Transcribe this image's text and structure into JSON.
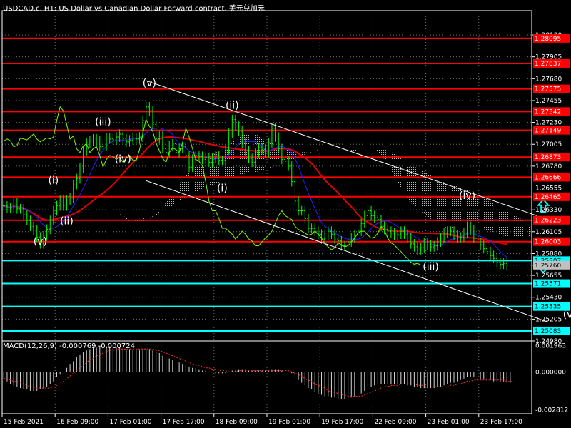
{
  "header": {
    "title": "USDCAD.c, H1:  US Dollar vs Canadian Dollar Forward contract, 美元兑加元"
  },
  "macd_label": "MACD(12,26,9) -0.000769 -0.000724",
  "colors": {
    "background": "#000000",
    "grid": "#6e6e6e",
    "candle": "#00ff00",
    "level_line": "#ff0000",
    "support_line": "#00ffff",
    "channel": "#ffffff",
    "kijun": "#e00000",
    "tenkan": "#2020ff",
    "chikou": "#7cfc00",
    "cloud_dots": "#d9d9d9",
    "macd_hist": "#d9d9d9",
    "macd_signal": "#ff3333",
    "label_text": "#ffffff"
  },
  "chart_data": [
    {
      "type": "line",
      "symbol": "USDCAD.c",
      "timeframe": "H1",
      "ylim": [
        1.2498,
        1.2838
      ],
      "y_ticks": [
        "1.28130",
        "1.27905",
        "1.27680",
        "1.27455",
        "1.27230",
        "1.27005",
        "1.26780",
        "1.26555",
        "1.26330",
        "1.26105",
        "1.25880",
        "1.25760",
        "1.25655",
        "1.25430",
        "1.25205",
        "1.24980"
      ],
      "x_ticks": [
        "15 Feb 2021",
        "16 Feb 09:00",
        "17 Feb 01:00",
        "17 Feb 17:00",
        "18 Feb 09:00",
        "19 Feb 01:00",
        "19 Feb 17:00",
        "22 Feb 09:00",
        "23 Feb 01:00",
        "23 Feb 17:00"
      ],
      "red_levels": [
        {
          "label": "1.28095",
          "value": 1.28095
        },
        {
          "label": "1.27837",
          "value": 1.27837
        },
        {
          "label": "1.27575",
          "value": 1.27575
        },
        {
          "label": "1.27342",
          "value": 1.27342
        },
        {
          "label": "1.27149",
          "value": 1.27149
        },
        {
          "label": "1.26873",
          "value": 1.26873
        },
        {
          "label": "1.26666",
          "value": 1.26666
        },
        {
          "label": "1.26465",
          "value": 1.26465
        },
        {
          "label": "1.26223",
          "value": 1.26223
        },
        {
          "label": "1.26003",
          "value": 1.26003
        }
      ],
      "cyan_levels": [
        {
          "label": "1.25807",
          "value": 1.25807
        },
        {
          "label": "1.25571",
          "value": 1.25571
        },
        {
          "label": "1.25335",
          "value": 1.25335
        },
        {
          "label": "1.25083",
          "value": 1.25083
        }
      ],
      "current_price": {
        "label": "1.25760",
        "value": 1.2576
      },
      "wave_labels": [
        {
          "text": "(v)",
          "bar": 44,
          "price": 1.276
        },
        {
          "text": "(iii)",
          "bar": 30,
          "price": 1.272
        },
        {
          "text": "(iv)",
          "bar": 36,
          "price": 1.2682
        },
        {
          "text": "(ii)",
          "bar": 69,
          "price": 1.2737
        },
        {
          "text": "(i)",
          "bar": 66,
          "price": 1.2652
        },
        {
          "text": "(i)",
          "bar": 15,
          "price": 1.266
        },
        {
          "text": "(ii)",
          "bar": 19,
          "price": 1.2618
        },
        {
          "text": "(v)",
          "bar": 11,
          "price": 1.2597
        },
        {
          "text": "(iii)",
          "bar": 129,
          "price": 1.2571
        },
        {
          "text": "(iv)",
          "bar": 140,
          "price": 1.2644
        },
        {
          "text": "(v)",
          "bar": 171,
          "price": 1.2522
        }
      ],
      "channel_lines": [
        {
          "bar1": 43,
          "price1": 1.2766,
          "bar2": 161,
          "price2": 1.2627
        },
        {
          "bar1": 43,
          "price1": 1.2663,
          "bar2": 164,
          "price2": 1.2518
        }
      ],
      "arrows": [
        {
          "direction": "up",
          "bar": 163,
          "price": 1.2637
        },
        {
          "direction": "down",
          "bar": 163,
          "price": 1.2575
        }
      ],
      "series": [
        {
          "kind": "close",
          "values": [
            1.2637,
            1.2635,
            1.2635,
            1.264,
            1.2634,
            1.2634,
            1.2628,
            1.2622,
            1.2616,
            1.2612,
            1.2605,
            1.2598,
            1.2606,
            1.2613,
            1.2622,
            1.2632,
            1.2637,
            1.2643,
            1.2637,
            1.2643,
            1.2645,
            1.2659,
            1.2665,
            1.2676,
            1.2694,
            1.2702,
            1.2704,
            1.2706,
            1.2704,
            1.2698,
            1.2699,
            1.2707,
            1.2706,
            1.2705,
            1.2708,
            1.2711,
            1.2706,
            1.2703,
            1.2705,
            1.2707,
            1.2706,
            1.2708,
            1.2725,
            1.2739,
            1.2735,
            1.2721,
            1.2706,
            1.2709,
            1.2696,
            1.2692,
            1.2699,
            1.2701,
            1.2692,
            1.2696,
            1.2698,
            1.2689,
            1.2677,
            1.2685,
            1.2689,
            1.2688,
            1.2685,
            1.2687,
            1.2682,
            1.2686,
            1.2689,
            1.2684,
            1.2684,
            1.2695,
            1.2712,
            1.2726,
            1.2719,
            1.2714,
            1.2702,
            1.2694,
            1.2686,
            1.2682,
            1.2692,
            1.2697,
            1.2695,
            1.2692,
            1.2702,
            1.2717,
            1.2708,
            1.2696,
            1.2685,
            1.2683,
            1.2678,
            1.2662,
            1.2642,
            1.2632,
            1.2632,
            1.2624,
            1.2614,
            1.2614,
            1.2611,
            1.2608,
            1.2603,
            1.2607,
            1.2611,
            1.2608,
            1.2603,
            1.2601,
            1.2596,
            1.2596,
            1.26,
            1.2604,
            1.2607,
            1.2611,
            1.2619,
            1.2627,
            1.2632,
            1.2627,
            1.2625,
            1.2623,
            1.2616,
            1.2613,
            1.2611,
            1.2609,
            1.2607,
            1.2608,
            1.2611,
            1.2608,
            1.2604,
            1.2598,
            1.2595,
            1.2592,
            1.2594,
            1.2599,
            1.2597,
            1.2595,
            1.2596,
            1.26,
            1.2604,
            1.2609,
            1.2611,
            1.2611,
            1.2607,
            1.2604,
            1.2605,
            1.2609,
            1.2616,
            1.2612,
            1.2604,
            1.2599,
            1.2597,
            1.2593,
            1.259,
            1.2586,
            1.2583,
            1.2579,
            1.2577,
            1.2578,
            1.2576
          ]
        }
      ]
    },
    {
      "type": "bar",
      "name": "MACD(12,26,9)",
      "ylim": [
        -0.0031,
        0.0023
      ],
      "y_ticks": [
        "0.001963",
        "0.000000",
        "-0.002812"
      ],
      "series": [
        {
          "kind": "main",
          "values": [
            -0.0005,
            -0.0007,
            -0.0009,
            -0.001,
            -0.0011,
            -0.0012,
            -0.0013,
            -0.0013,
            -0.0014,
            -0.0014,
            -0.0014,
            -0.0013,
            -0.0012,
            -0.0011,
            -0.0009,
            -0.0007,
            -0.0004,
            -0.0002,
            0.0,
            0.0003,
            0.0006,
            0.0008,
            0.0011,
            0.0013,
            0.0015,
            0.0016,
            0.0017,
            0.0018,
            0.0018,
            0.0019,
            0.0019,
            0.0019,
            0.0019,
            0.0018,
            0.0018,
            0.0018,
            0.0017,
            0.0017,
            0.0017,
            0.0016,
            0.0016,
            0.0016,
            0.0016,
            0.0017,
            0.0017,
            0.0016,
            0.0015,
            0.0014,
            0.0012,
            0.0011,
            0.001,
            0.0009,
            0.0008,
            0.0007,
            0.0006,
            0.0005,
            0.0004,
            0.0003,
            0.0003,
            0.0002,
            0.0001,
            0.0001,
            0.0,
            -0.0,
            -0.0001,
            -0.0001,
            -0.0001,
            -0.0001,
            -0.0,
            0.0001,
            0.0001,
            0.0002,
            0.0002,
            0.0002,
            0.0001,
            0.0001,
            0.0001,
            0.0001,
            0.0001,
            0.0001,
            0.0001,
            0.0002,
            0.0002,
            0.0002,
            0.0001,
            0.0001,
            0.0,
            -0.0001,
            -0.0004,
            -0.0006,
            -0.0008,
            -0.001,
            -0.0012,
            -0.0013,
            -0.0015,
            -0.0016,
            -0.0017,
            -0.0018,
            -0.0018,
            -0.0019,
            -0.0019,
            -0.002,
            -0.002,
            -0.002,
            -0.002,
            -0.0019,
            -0.0018,
            -0.0017,
            -0.0016,
            -0.0014,
            -0.0012,
            -0.0011,
            -0.001,
            -0.0009,
            -0.0009,
            -0.0009,
            -0.0009,
            -0.0009,
            -0.0009,
            -0.0009,
            -0.0009,
            -0.0009,
            -0.001,
            -0.001,
            -0.0011,
            -0.0011,
            -0.0012,
            -0.0012,
            -0.0012,
            -0.0012,
            -0.0012,
            -0.0011,
            -0.0011,
            -0.001,
            -0.0009,
            -0.0008,
            -0.0008,
            -0.0007,
            -0.0006,
            -0.0005,
            -0.0004,
            -0.0004,
            -0.0004,
            -0.0005,
            -0.0005,
            -0.0005,
            -0.0006,
            -0.0006,
            -0.0007,
            -0.0007,
            -0.0007,
            -0.0007,
            -0.0007,
            -0.0008
          ]
        },
        {
          "kind": "signal",
          "values": [
            -0.0005,
            -0.0005,
            -0.0006,
            -0.0007,
            -0.0007,
            -0.0008,
            -0.0009,
            -0.001,
            -0.0011,
            -0.0011,
            -0.0012,
            -0.0012,
            -0.0012,
            -0.0012,
            -0.0012,
            -0.0011,
            -0.001,
            -0.0008,
            -0.0007,
            -0.0005,
            -0.0003,
            -0.0001,
            0.0001,
            0.0003,
            0.0005,
            0.0007,
            0.0009,
            0.001,
            0.0012,
            0.0013,
            0.0014,
            0.0015,
            0.0016,
            0.0016,
            0.0017,
            0.0017,
            0.0017,
            0.0017,
            0.0017,
            0.0017,
            0.0017,
            0.0017,
            0.0017,
            0.0017,
            0.0017,
            0.0017,
            0.0016,
            0.0016,
            0.0015,
            0.0014,
            0.0013,
            0.0012,
            0.0011,
            0.001,
            0.0009,
            0.0008,
            0.0007,
            0.0006,
            0.0005,
            0.0005,
            0.0004,
            0.0003,
            0.0003,
            0.0002,
            0.0002,
            0.0001,
            0.0001,
            0.0001,
            0.0,
            0.0,
            0.0,
            0.0001,
            0.0001,
            0.0001,
            0.0001,
            0.0001,
            0.0001,
            0.0001,
            0.0001,
            0.0001,
            0.0001,
            0.0001,
            0.0001,
            0.0001,
            0.0001,
            0.0001,
            0.0001,
            0.0,
            -0.0001,
            -0.0002,
            -0.0003,
            -0.0005,
            -0.0006,
            -0.0007,
            -0.0009,
            -0.001,
            -0.0011,
            -0.0012,
            -0.0014,
            -0.0015,
            -0.0015,
            -0.0016,
            -0.0017,
            -0.0017,
            -0.0018,
            -0.0018,
            -0.0018,
            -0.0018,
            -0.0018,
            -0.0017,
            -0.0016,
            -0.0015,
            -0.0014,
            -0.0013,
            -0.0012,
            -0.0011,
            -0.0011,
            -0.001,
            -0.001,
            -0.001,
            -0.0009,
            -0.0009,
            -0.0009,
            -0.0009,
            -0.0009,
            -0.001,
            -0.001,
            -0.001,
            -0.0011,
            -0.0011,
            -0.0011,
            -0.0011,
            -0.0011,
            -0.0011,
            -0.0011,
            -0.001,
            -0.001,
            -0.0009,
            -0.0009,
            -0.0008,
            -0.0007,
            -0.0007,
            -0.0006,
            -0.0006,
            -0.0006,
            -0.0006,
            -0.0006,
            -0.0006,
            -0.0006,
            -0.0006,
            -0.0006,
            -0.0006,
            -0.0007,
            -0.0007,
            -0.0007
          ]
        }
      ]
    }
  ]
}
